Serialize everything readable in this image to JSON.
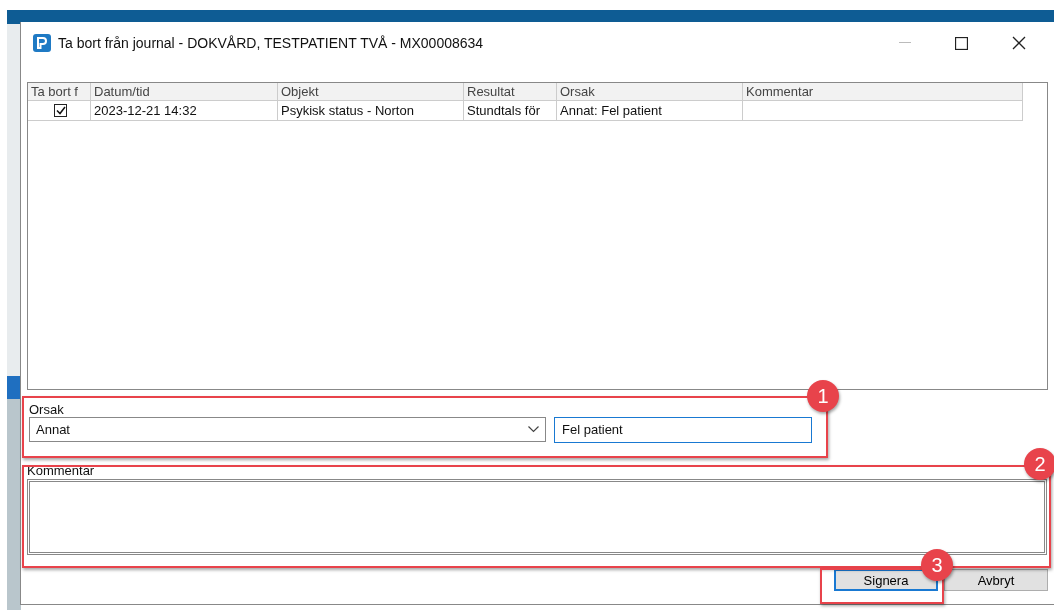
{
  "window": {
    "title": "Ta bort från journal - DOKVÅRD, TESTPATIENT TVÅ - MX00008634"
  },
  "table": {
    "columns": [
      "Ta bort f",
      "Datum/tid",
      "Objekt",
      "Resultat",
      "Orsak",
      "Kommentar"
    ],
    "rows": [
      {
        "checked": true,
        "cells": [
          "",
          "2023-12-21 14:32",
          "Psykisk status - Norton",
          "Stundtals för",
          "Annat: Fel patient",
          ""
        ]
      }
    ]
  },
  "orsak": {
    "label": "Orsak",
    "select_value": "Annat",
    "text_value": "Fel patient",
    "badge": "1"
  },
  "kommentar": {
    "label": "Kommentar",
    "badge": "2"
  },
  "buttons": [
    {
      "label": "Signera",
      "focused": true,
      "badge": "3"
    },
    {
      "label": "Avbryt",
      "focused": false
    }
  ]
}
